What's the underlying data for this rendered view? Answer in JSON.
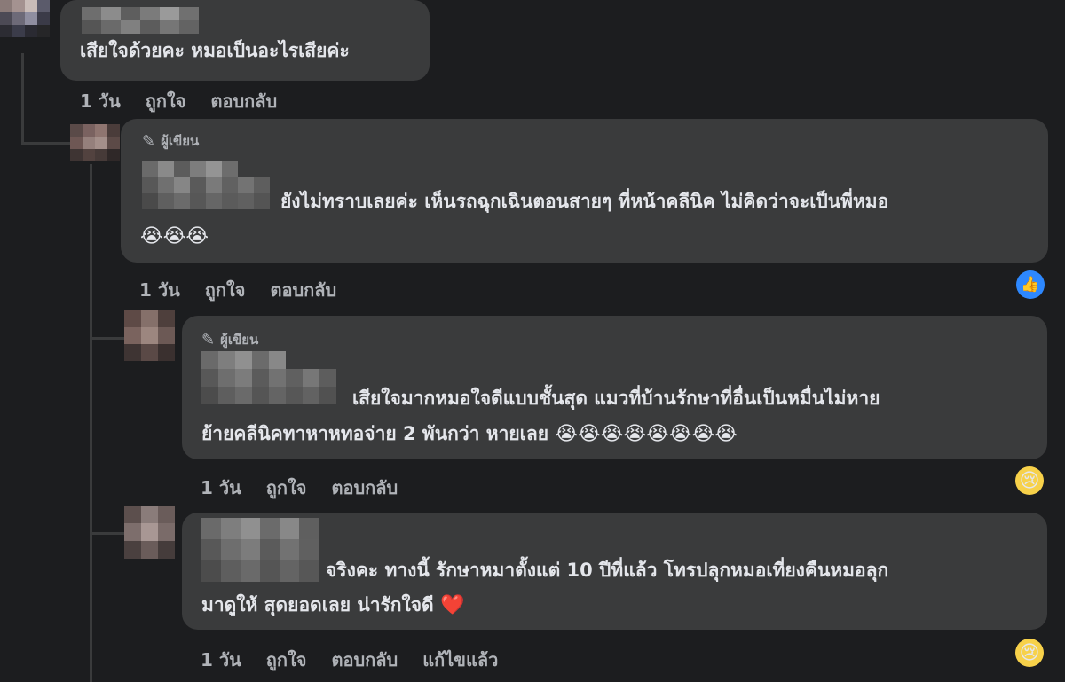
{
  "comments": [
    {
      "text_line1": "เสียใจด้วยคะ หมอเป็นอะไรเสียค่ะ",
      "actions": [
        "1 วัน",
        "ถูกใจ",
        "ตอบกลับ"
      ]
    },
    {
      "badge": "ผู้เขียน",
      "text_line1": "ยังไม่ทราบเลยค่ะ เห็นรถฉุกเฉินตอนสายๆ ที่หน้าคลีนิค ไม่คิดว่าจะเป็นพี่หมอ",
      "emojis": "😭😭😭",
      "actions": [
        "1 วัน",
        "ถูกใจ",
        "ตอบกลับ"
      ]
    },
    {
      "badge": "ผู้เขียน",
      "text_line1": "เสียใจมากหมอใจดีแบบชั้นสุด แมวที่บ้านรักษาที่อื่นเป็นหมื่นไม่หาย",
      "text_line2": "ย้ายคลีนิคทาหาหทอจ่าย 2 พันกว่า หายเลย",
      "emojis": "😭😭😭😭😭😭😭😭",
      "actions": [
        "1 วัน",
        "ถูกใจ",
        "ตอบกลับ"
      ]
    },
    {
      "text_line1": "จริงคะ ทางนี้ รักษาหมาตั้งแต่ 10 ปีที่แล้ว โทรปลุกหมอเที่ยงคืนหมอลุก",
      "text_line2": "มาดูให้ สุดยอดเลย น่ารักใจดี",
      "emoji_heart": "❤️",
      "actions": [
        "1 วัน",
        "ถูกใจ",
        "ตอบกลับ",
        "แก้ไขแล้ว"
      ]
    }
  ],
  "reactions": {
    "like": "👍",
    "sad": "😢"
  },
  "icons": {
    "pencil": "✎"
  }
}
